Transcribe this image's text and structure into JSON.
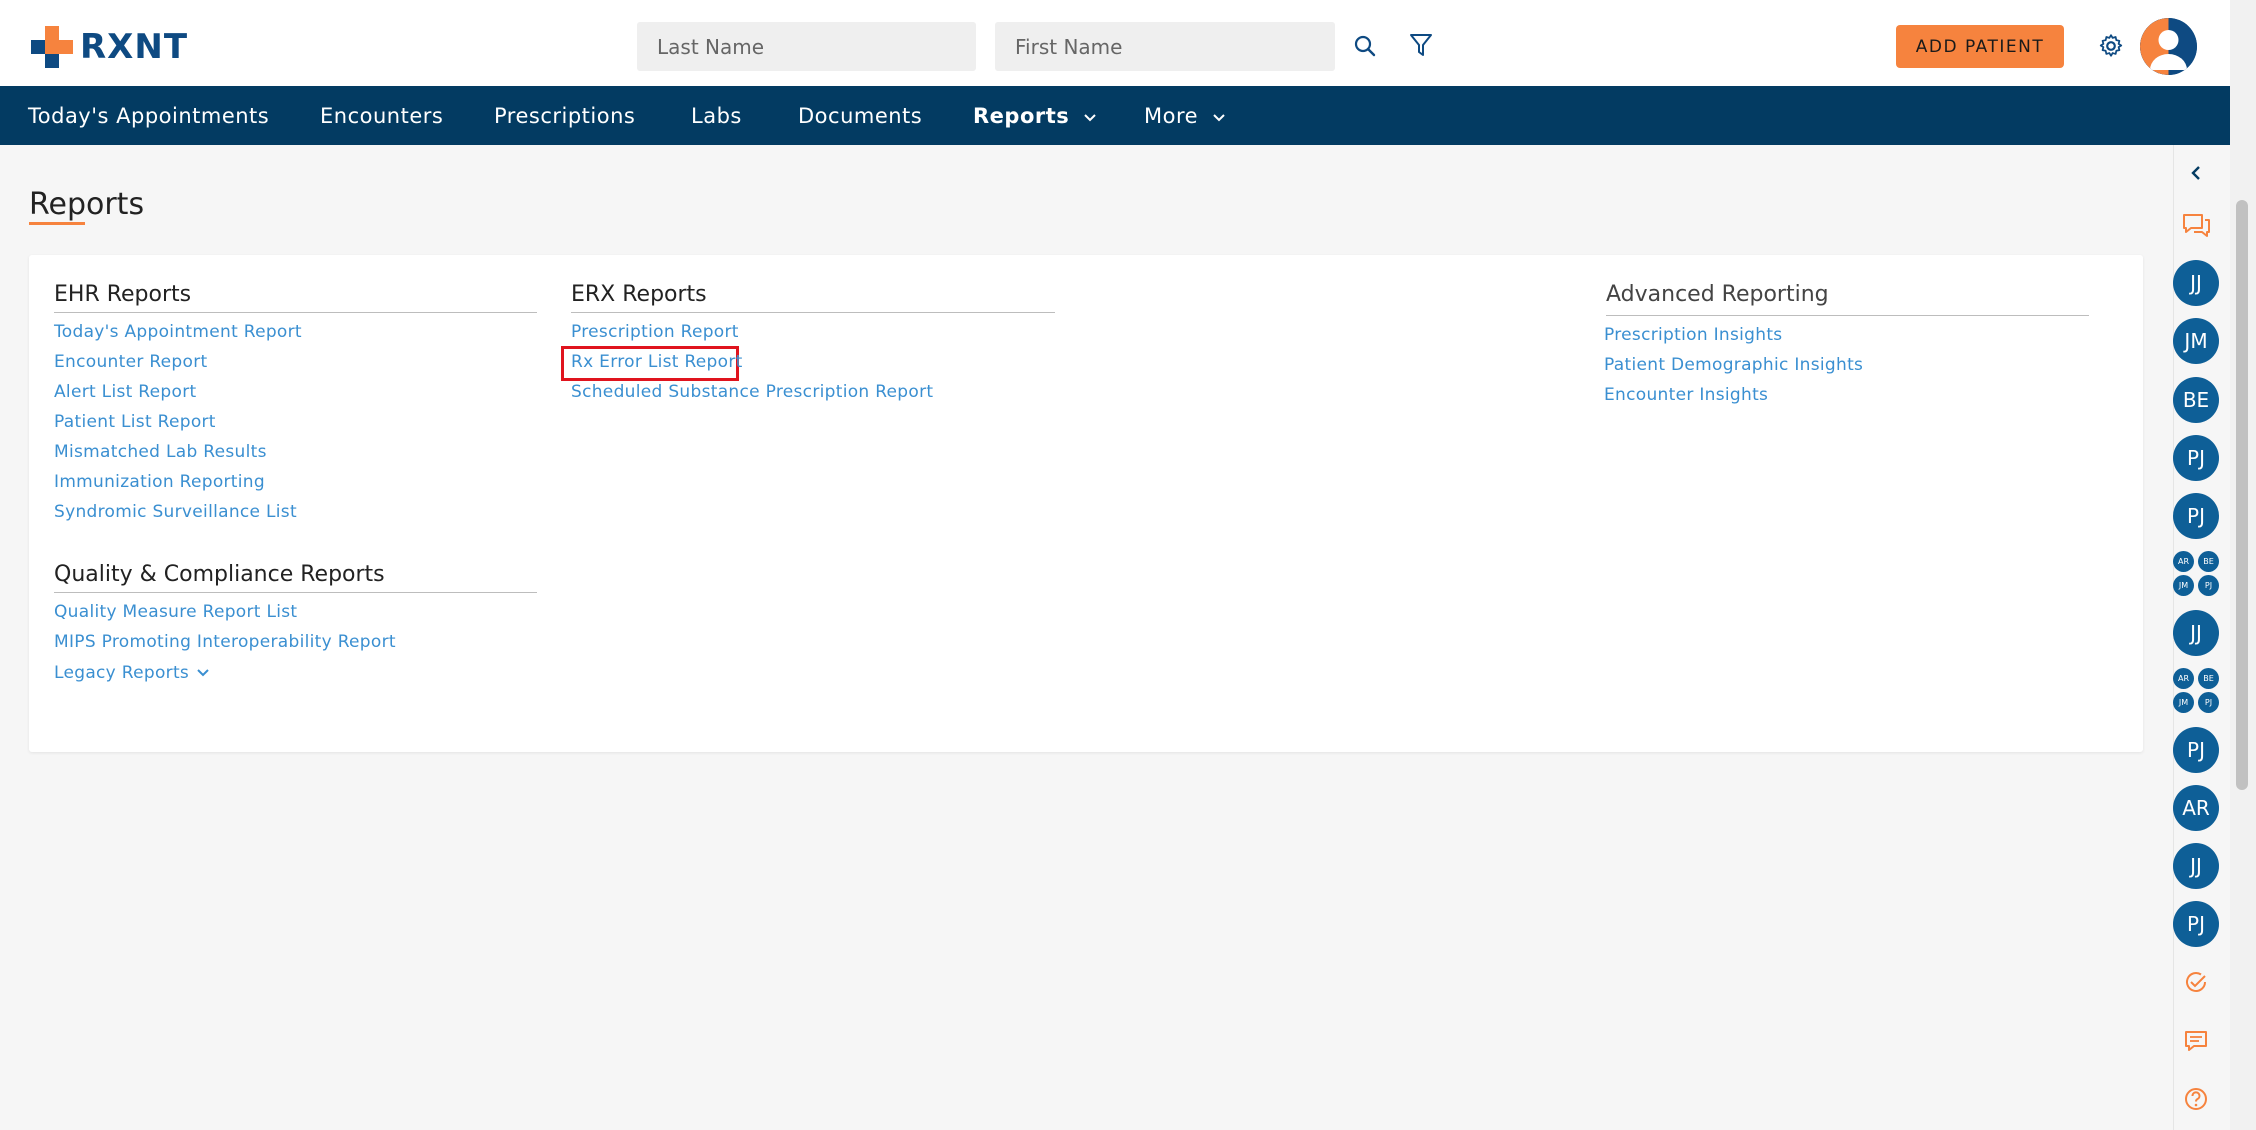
{
  "app": {
    "logo_text": "RXNT",
    "brand_color": "#0e4a82",
    "accent_color": "#f6833e"
  },
  "header": {
    "last_name_placeholder": "Last Name",
    "first_name_placeholder": "First Name",
    "search_icon": "search-icon",
    "filter_icon": "filter-icon",
    "add_patient_label": "ADD PATIENT",
    "settings_icon": "gear-icon",
    "avatar_icon": "user-avatar-icon"
  },
  "nav": {
    "items": [
      {
        "label": "Today's Appointments"
      },
      {
        "label": "Encounters"
      },
      {
        "label": "Prescriptions"
      },
      {
        "label": "Labs"
      },
      {
        "label": "Documents"
      },
      {
        "label": "Reports"
      },
      {
        "label": "More"
      }
    ]
  },
  "page": {
    "title": "Reports"
  },
  "sections": {
    "ehr": {
      "title": "EHR Reports",
      "links": [
        "Today's Appointment Report",
        "Encounter Report",
        "Alert List Report",
        "Patient List Report",
        "Mismatched Lab Results",
        "Immunization Reporting",
        "Syndromic Surveillance List"
      ]
    },
    "quality": {
      "title": "Quality & Compliance Reports",
      "links": [
        "Quality Measure Report List",
        "MIPS Promoting Interoperability Report",
        "Legacy Reports"
      ]
    },
    "erx": {
      "title": "ERX Reports",
      "links": [
        "Prescription Report",
        "Rx Error List Report",
        "Scheduled Substance Prescription Report"
      ]
    },
    "advanced": {
      "title": "Advanced Reporting",
      "links": [
        "Prescription Insights",
        "Patient Demographic Insights",
        "Encounter Insights"
      ]
    }
  },
  "rail": {
    "avatars": [
      "JJ",
      "JM",
      "BE",
      "PJ",
      "PJ",
      "JJ",
      "PJ",
      "AR",
      "JJ",
      "PJ"
    ],
    "group": [
      "AR",
      "BE",
      "JM",
      "PJ"
    ]
  }
}
